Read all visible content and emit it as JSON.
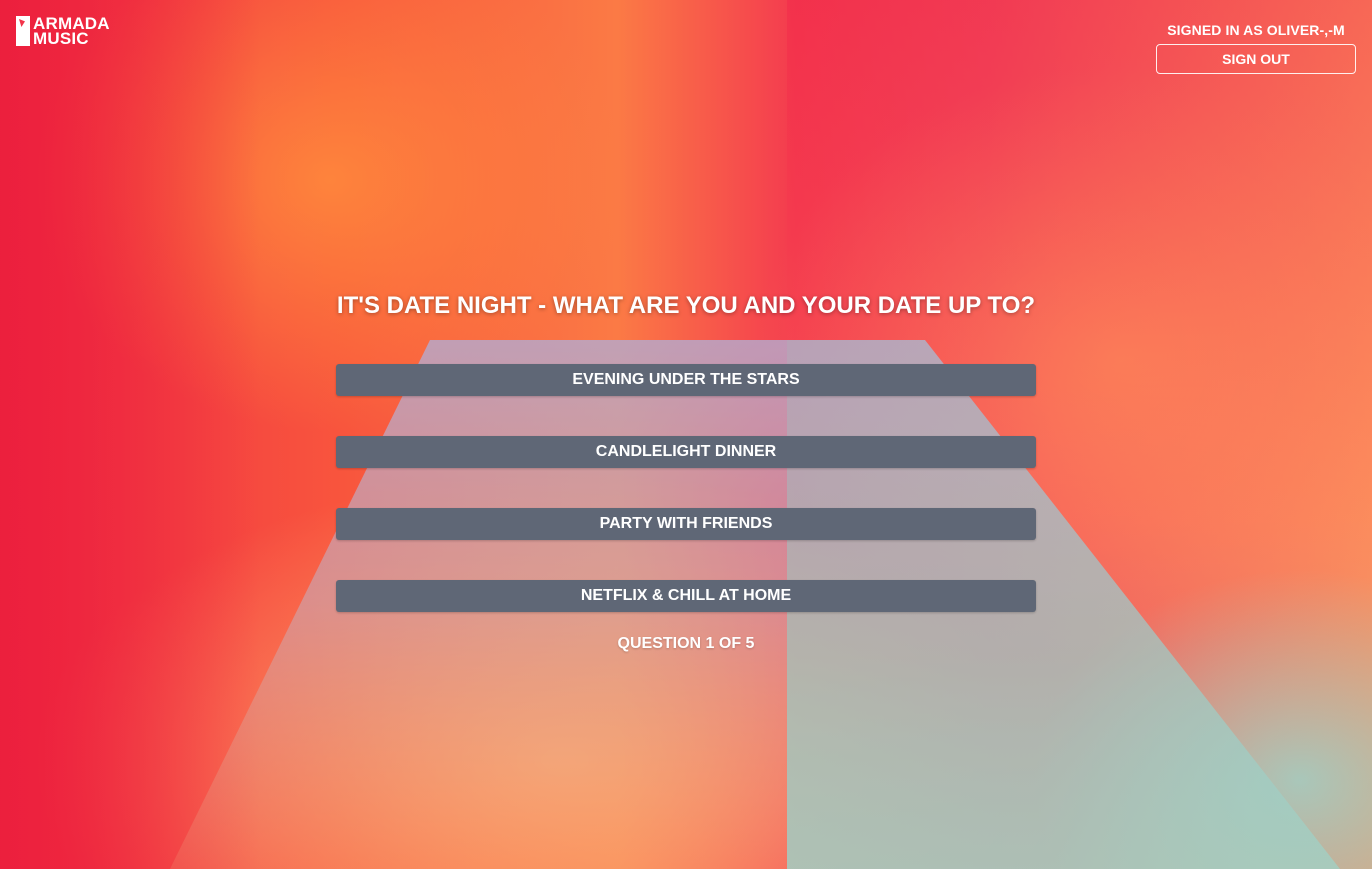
{
  "header": {
    "logo_line1": "ARMADA",
    "logo_line2": "MUSIC",
    "signed_in_text": "SIGNED IN AS OLIVER-,-M",
    "sign_out_label": "SIGN OUT"
  },
  "quiz": {
    "question": "IT'S DATE NIGHT - WHAT ARE YOU AND YOUR DATE UP TO?",
    "answers": [
      "EVENING UNDER THE STARS",
      "CANDLELIGHT DINNER",
      "PARTY WITH FRIENDS",
      "NETFLIX & CHILL AT HOME"
    ],
    "progress_text": "QUESTION 1 OF 5"
  },
  "colors": {
    "background_accent": "#f2344a",
    "answer_button": "#5f6776",
    "text": "#ffffff"
  }
}
